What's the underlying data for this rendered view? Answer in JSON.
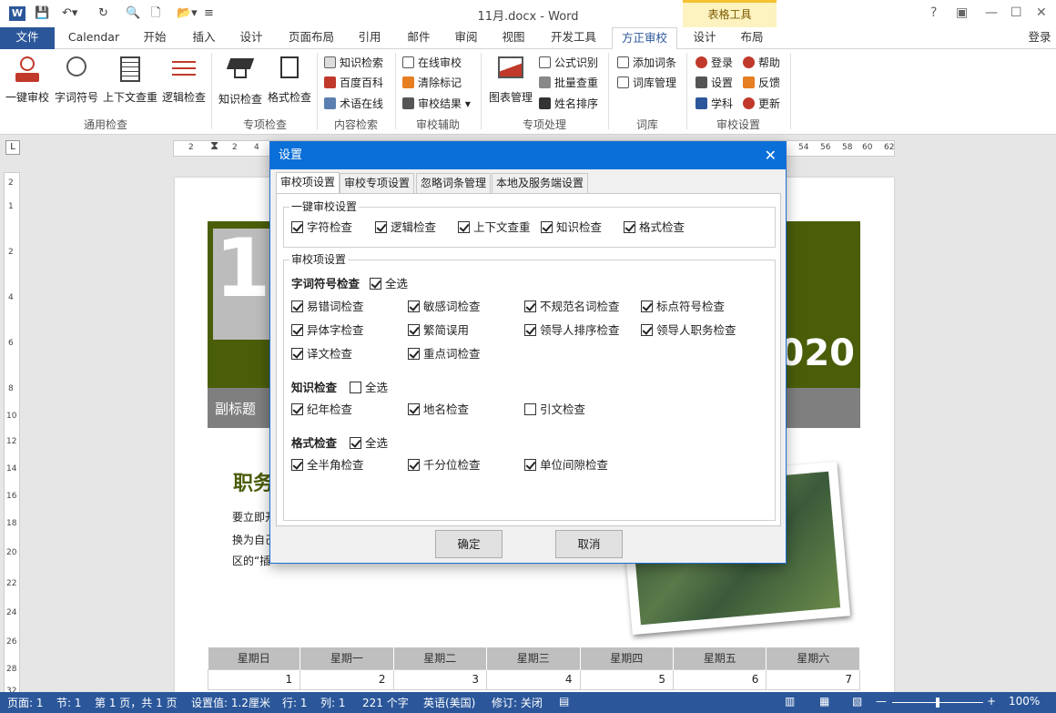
{
  "titlebar": {
    "doc_title": "11月.docx - Word",
    "context_title": "表格工具",
    "login": "登录",
    "help": "?"
  },
  "tabs": {
    "file": "文件",
    "items": [
      "Calendar",
      "开始",
      "插入",
      "设计",
      "页面布局",
      "引用",
      "邮件",
      "审阅",
      "视图",
      "开发工具",
      "方正审校",
      "设计",
      "布局"
    ]
  },
  "ribbon": {
    "big": [
      "一键审校",
      "字词符号",
      "上下文查重",
      "逻辑检查",
      "知识检查",
      "格式检查",
      "图表管理"
    ],
    "small": {
      "content": [
        "知识检索",
        "百度百科",
        "术语在线"
      ],
      "assist": [
        "在线审校",
        "清除标记",
        "审校结果"
      ],
      "process": [
        "公式识别",
        "批量查重",
        "姓名排序"
      ],
      "lexicon": [
        "添加词条",
        "词库管理"
      ],
      "settings": [
        "登录",
        "设置",
        "学科"
      ],
      "help": [
        "帮助",
        "反馈",
        "更新"
      ]
    },
    "groups": [
      "通用检查",
      "专项检查",
      "内容检索",
      "审校辅助",
      "专项处理",
      "词库",
      "审校设置"
    ]
  },
  "ruler": {
    "h": [
      "2",
      "2",
      "4",
      "54",
      "56",
      "58",
      "60",
      "62"
    ],
    "v": [
      "2",
      "1",
      "2",
      "4",
      "6",
      "8",
      "10",
      "12",
      "14",
      "16",
      "18",
      "20",
      "22",
      "24",
      "26",
      "28",
      "32"
    ]
  },
  "doc": {
    "big_num": "1",
    "year": "020",
    "subtitle": "副标题",
    "duty": "职务",
    "lines": [
      "要立即开",
      "换为自己",
      "区的“插"
    ]
  },
  "calendar": {
    "headers": [
      "星期日",
      "星期一",
      "星期二",
      "星期三",
      "星期四",
      "星期五",
      "星期六"
    ],
    "row": [
      "1",
      "2",
      "3",
      "4",
      "5",
      "6",
      "7"
    ]
  },
  "status": {
    "page": "页面: 1",
    "section": "节: 1",
    "pages": "第 1 页，共 1 页",
    "setting": "设置值: 1.2厘米",
    "row": "行: 1",
    "col": "列: 1",
    "words": "221 个字",
    "lang": "英语(美国)",
    "rev": "修订: 关闭",
    "zoom": "100%"
  },
  "dialog": {
    "title": "设置",
    "close": "✕",
    "tabs": [
      "审校项设置",
      "审校专项设置",
      "忽略词条管理",
      "本地及服务端设置"
    ],
    "oneclick": {
      "title": "一键审校设置",
      "items": [
        {
          "label": "字符检查",
          "checked": true
        },
        {
          "label": "逻辑检查",
          "checked": true
        },
        {
          "label": "上下文查重",
          "checked": true
        },
        {
          "label": "知识检查",
          "checked": true
        },
        {
          "label": "格式检查",
          "checked": true
        }
      ]
    },
    "items_title": "审校项设置",
    "char": {
      "title": "字词符号检查",
      "all": "全选",
      "all_checked": true,
      "items": [
        {
          "label": "易错词检查",
          "checked": true
        },
        {
          "label": "敏感词检查",
          "checked": true
        },
        {
          "label": "不规范名词检查",
          "checked": true
        },
        {
          "label": "标点符号检查",
          "checked": true
        },
        {
          "label": "异体字检查",
          "checked": true
        },
        {
          "label": "繁简误用",
          "checked": true
        },
        {
          "label": "领导人排序检查",
          "checked": true
        },
        {
          "label": "领导人职务检查",
          "checked": true
        },
        {
          "label": "译文检查",
          "checked": true
        },
        {
          "label": "重点词检查",
          "checked": true
        }
      ]
    },
    "knowledge": {
      "title": "知识检查",
      "all": "全选",
      "all_checked": false,
      "items": [
        {
          "label": "纪年检查",
          "checked": true
        },
        {
          "label": "地名检查",
          "checked": true
        },
        {
          "label": "引文检查",
          "checked": false
        }
      ]
    },
    "format": {
      "title": "格式检查",
      "all": "全选",
      "all_checked": true,
      "items": [
        {
          "label": "全半角检查",
          "checked": true
        },
        {
          "label": "千分位检查",
          "checked": true
        },
        {
          "label": "单位间隙检查",
          "checked": true
        }
      ]
    },
    "ok": "确定",
    "cancel": "取消"
  },
  "colors": {
    "accent": "#2b579a",
    "dialog_title": "#0a6fd8",
    "banner": "#4a5e0a"
  }
}
